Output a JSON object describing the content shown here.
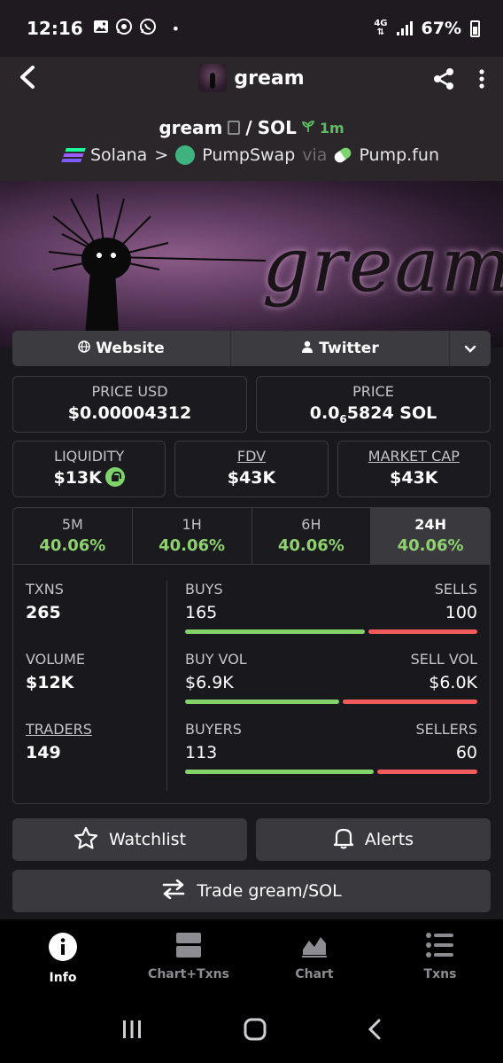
{
  "status": {
    "time": "12:16",
    "dot": "•",
    "net_top": "4G",
    "net_bottom": "⇅",
    "battery": "67%"
  },
  "header": {
    "title": "gream",
    "pair_base": "gream",
    "pair_sep": "/",
    "pair_quote": "SOL",
    "age": "1m",
    "chain": "Solana",
    "chain_sep": ">",
    "dex": "PumpSwap",
    "via": "via",
    "launchpad": "Pump.fun"
  },
  "banner": {
    "text": "gream"
  },
  "links": {
    "website": "Website",
    "twitter": "Twitter"
  },
  "price": {
    "usd_label": "PRICE USD",
    "usd_value": "$0.00004312",
    "native_label": "PRICE",
    "native_prefix": "0.0",
    "native_zeros": "6",
    "native_digits": "5824",
    "native_unit": "SOL"
  },
  "metrics": {
    "liquidity_label": "LIQUIDITY",
    "liquidity_value": "$13K",
    "fdv_label": "FDV",
    "fdv_value": "$43K",
    "mcap_label": "MARKET CAP",
    "mcap_value": "$43K"
  },
  "timeframes": [
    {
      "label": "5M",
      "value": "40.06%"
    },
    {
      "label": "1H",
      "value": "40.06%"
    },
    {
      "label": "6H",
      "value": "40.06%"
    },
    {
      "label": "24H",
      "value": "40.06%"
    }
  ],
  "stats": {
    "txns_label": "TXNS",
    "txns_value": "265",
    "buys_label": "BUYS",
    "buys_value": "165",
    "sells_label": "SELLS",
    "sells_value": "100",
    "volume_label": "VOLUME",
    "volume_value": "$12K",
    "buyvol_label": "BUY VOL",
    "buyvol_value": "$6.9K",
    "sellvol_label": "SELL VOL",
    "sellvol_value": "$6.0K",
    "traders_label": "TRADERS",
    "traders_value": "149",
    "buyers_label": "BUYERS",
    "buyers_value": "113",
    "sellers_label": "SELLERS",
    "sellers_value": "60"
  },
  "actions": {
    "watchlist": "Watchlist",
    "alerts": "Alerts",
    "trade": "Trade gream/SOL"
  },
  "bottom_nav": {
    "info": "Info",
    "chart_txns": "Chart+Txns",
    "chart": "Chart",
    "txns": "Txns"
  },
  "colors": {
    "buy": "#84d36a",
    "sell": "#f15b5b",
    "positive": "#8fd16f"
  }
}
